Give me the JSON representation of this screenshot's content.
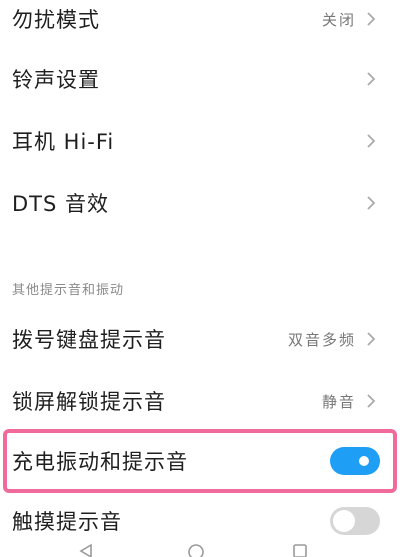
{
  "settings": {
    "dnd": {
      "label": "勿扰模式",
      "value": "关闭"
    },
    "ringtone": {
      "label": "铃声设置"
    },
    "hifi": {
      "label": "耳机 Hi-Fi"
    },
    "dts": {
      "label": "DTS 音效"
    }
  },
  "section": {
    "title": "其他提示音和振动",
    "dialpad": {
      "label": "拨号键盘提示音",
      "value": "双音多频"
    },
    "lockscreen": {
      "label": "锁屏解锁提示音",
      "value": "静音"
    },
    "charging": {
      "label": "充电振动和提示音",
      "enabled": true
    },
    "touch": {
      "label": "触摸提示音",
      "enabled": false
    }
  },
  "icons": {
    "chevron": "chevron-right-icon",
    "nav_back": "back-triangle-icon",
    "nav_home": "home-circle-icon",
    "nav_recent": "recent-square-icon"
  },
  "colors": {
    "toggle_on": "#1e9ef4",
    "toggle_off": "#d6d6d6",
    "highlight": "#f06a9b"
  }
}
